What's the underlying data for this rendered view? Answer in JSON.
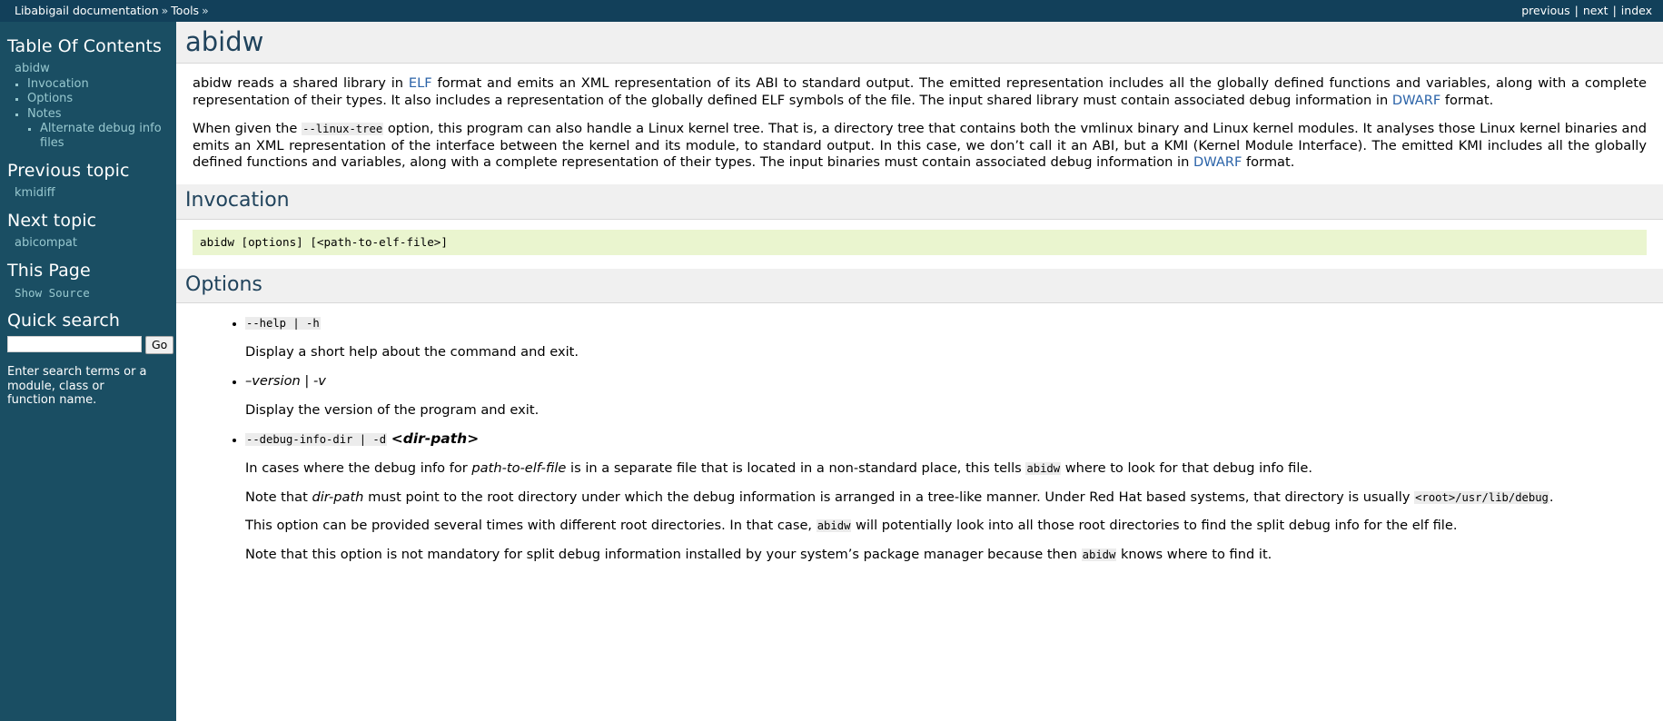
{
  "breadcrumb": {
    "root": "Libabigail documentation",
    "sep1": "»",
    "section": "Tools",
    "sep2": "»"
  },
  "topnav": {
    "previous": "previous",
    "next": "next",
    "index": "index",
    "pipe": "|"
  },
  "sidebar": {
    "toc_title": "Table Of Contents",
    "toc": {
      "root": "abidw",
      "items": [
        {
          "label": "Invocation"
        },
        {
          "label": "Options"
        },
        {
          "label": "Notes",
          "children": [
            {
              "label": "Alternate debug info files"
            }
          ]
        }
      ]
    },
    "previous_topic_title": "Previous topic",
    "previous_topic_link": "kmidiff",
    "next_topic_title": "Next topic",
    "next_topic_link": "abicompat",
    "this_page_title": "This Page",
    "show_source_link": "Show Source",
    "quick_search_title": "Quick search",
    "search_value": "",
    "search_placeholder": "",
    "search_go_label": "Go",
    "search_hint": "Enter search terms or a module, class or function name."
  },
  "main": {
    "title": "abidw",
    "intro_p1": {
      "t1": "abidw reads a shared library in ",
      "link1": "ELF",
      "t2": " format and emits an XML representation of its ABI to standard output. The emitted representation includes all the globally defined functions and variables, along with a complete representation of their types. It also includes a representation of the globally defined ELF symbols of the file. The input shared library must contain associated debug information in ",
      "link2": "DWARF",
      "t3": " format."
    },
    "intro_p2": {
      "t1": "When given the ",
      "code1": "--linux-tree",
      "t2": " option, this program can also handle a Linux kernel tree. That is, a directory tree that contains both the vmlinux binary and Linux kernel modules. It analyses those Linux kernel binaries and emits an XML representation of the interface between the kernel and its module, to standard output. In this case, we don’t call it an ABI, but a KMI (Kernel Module Interface). The emitted KMI includes all the globally defined functions and variables, along with a complete representation of their types. The input binaries must contain associated debug information in ",
      "link2": "DWARF",
      "t3": " format."
    },
    "invocation_heading": "Invocation",
    "invocation_code": "abidw [options] [<path-to-elf-file>]",
    "options_heading": "Options",
    "options": [
      {
        "code": "--help | -h",
        "style": "code",
        "paras": [
          {
            "t1": "Display a short help about the command and exit."
          }
        ]
      },
      {
        "code": "–version | -v",
        "style": "italic",
        "paras": [
          {
            "t1": "Display the version of the program and exit."
          }
        ]
      },
      {
        "code": "--debug-info-dir | -d",
        "style": "code",
        "arg": "<dir-path>",
        "paras": [
          {
            "t1": "In cases where the debug info for ",
            "em1": "path-to-elf-file",
            "t2": " is in a separate file that is located in a non-standard place, this tells ",
            "code1": "abidw",
            "t3": " where to look for that debug info file."
          },
          {
            "t1": "Note that ",
            "em1": "dir-path",
            "t2": " must point to the root directory under which the debug information is arranged in a tree-like manner. Under Red Hat based systems, that directory is usually ",
            "code1": "<root>/usr/lib/debug",
            "t3": "."
          },
          {
            "t1": "This option can be provided several times with different root directories. In that case, ",
            "code1": "abidw",
            "t2": " will potentially look into all those root directories to find the split debug info for the elf file."
          },
          {
            "t1": "Note that this option is not mandatory for split debug information installed by your system’s package manager because then ",
            "code1": "abidw",
            "t2": " knows where to find it."
          }
        ]
      }
    ]
  }
}
